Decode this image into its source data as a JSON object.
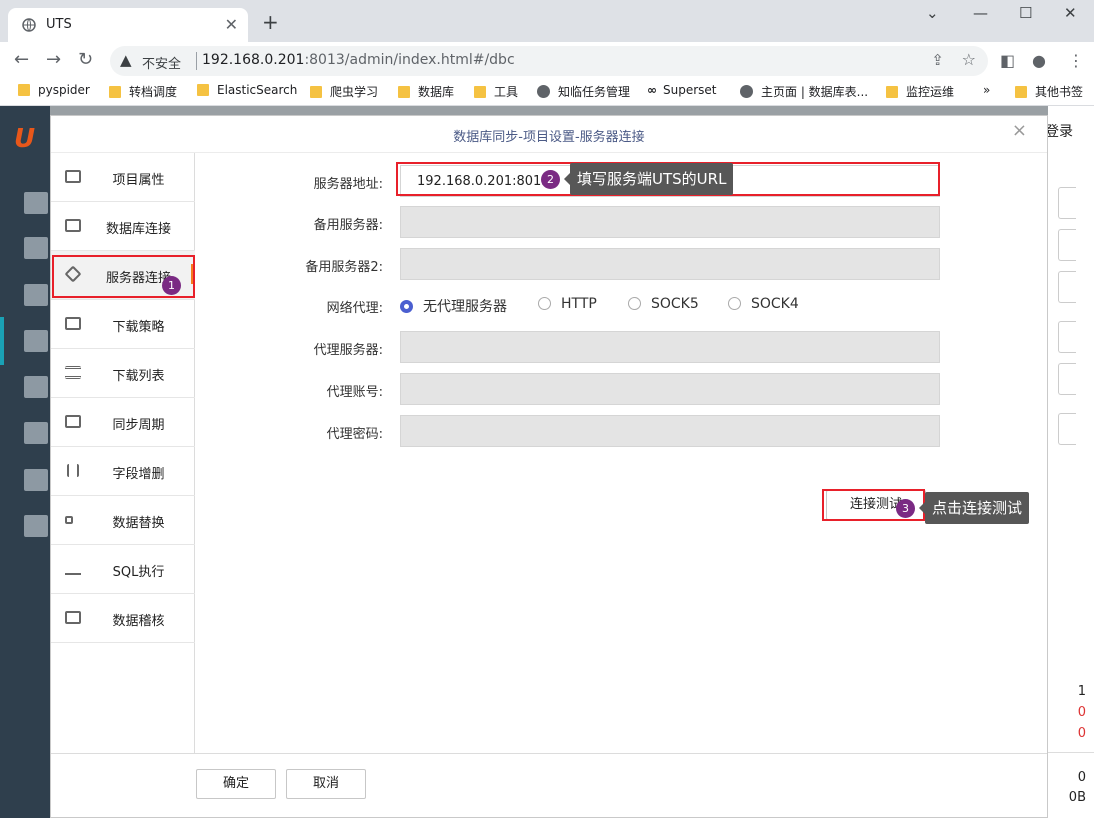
{
  "browser": {
    "tab_title": "UTS",
    "insecure_label": "不安全",
    "url_host": "192.168.0.201",
    "url_rest": ":8013/admin/index.html#/dbc",
    "bookmarks": [
      {
        "label": "pyspider",
        "icon": "folder-icon"
      },
      {
        "label": "转档调度",
        "icon": "folder-icon"
      },
      {
        "label": "ElasticSearch",
        "icon": "folder-icon"
      },
      {
        "label": "爬虫学习",
        "icon": "folder-icon"
      },
      {
        "label": "数据库",
        "icon": "folder-icon"
      },
      {
        "label": "工具",
        "icon": "folder-icon"
      },
      {
        "label": "知临任务管理",
        "icon": "globe-icon"
      },
      {
        "label": "Superset",
        "icon": "infinity-icon"
      },
      {
        "label": "主页面 | 数据库表...",
        "icon": "globe-icon"
      },
      {
        "label": "监控运维",
        "icon": "folder-icon"
      }
    ],
    "more_bookmarks": "»",
    "other_bookmarks": "其他书签"
  },
  "app": {
    "login_text": "登录",
    "numbers": [
      "1",
      "0",
      "0",
      "0",
      "0B"
    ]
  },
  "modal": {
    "title": "数据库同步-项目设置-服务器连接",
    "close": "×",
    "menu": [
      {
        "label": "项目属性",
        "icon": "card-icon"
      },
      {
        "label": "数据库连接",
        "icon": "chart-icon"
      },
      {
        "label": "服务器连接",
        "icon": "layers-icon"
      },
      {
        "label": "下载策略",
        "icon": "chart-icon"
      },
      {
        "label": "下载列表",
        "icon": "list-icon"
      },
      {
        "label": "同步周期",
        "icon": "clock-icon"
      },
      {
        "label": "字段增删",
        "icon": "columns-icon"
      },
      {
        "label": "数据替换",
        "icon": "swap-icon"
      },
      {
        "label": "SQL执行",
        "icon": "bar-chart-icon"
      },
      {
        "label": "数据稽核",
        "icon": "audit-icon"
      }
    ],
    "form": {
      "server_address_label": "服务器地址:",
      "server_address_value": "192.168.0.201:8013",
      "backup_server_label": "备用服务器:",
      "backup_server_value": "",
      "backup_server2_label": "备用服务器2:",
      "backup_server2_value": "",
      "proxy_label": "网络代理:",
      "proxy_options": [
        "无代理服务器",
        "HTTP",
        "SOCK5",
        "SOCK4"
      ],
      "proxy_selected": "无代理服务器",
      "proxy_server_label": "代理服务器:",
      "proxy_server_value": "",
      "proxy_account_label": "代理账号:",
      "proxy_account_value": "",
      "proxy_password_label": "代理密码:",
      "proxy_password_value": ""
    },
    "test_button": "连接测试",
    "ok_button": "确定",
    "cancel_button": "取消"
  },
  "annotations": {
    "badge1": "1",
    "badge2": "2",
    "badge3": "3",
    "callout2": "填写服务端UTS的URL",
    "callout3": "点击连接测试"
  },
  "colors": {
    "accent": "#4b5fd0",
    "active_menu_marker": "#f57c1f",
    "annotation_red": "#e8202a",
    "badge_purple": "#7a2a83",
    "callout_bg": "#575757",
    "sidebar_bg": "#2f3f4d"
  }
}
